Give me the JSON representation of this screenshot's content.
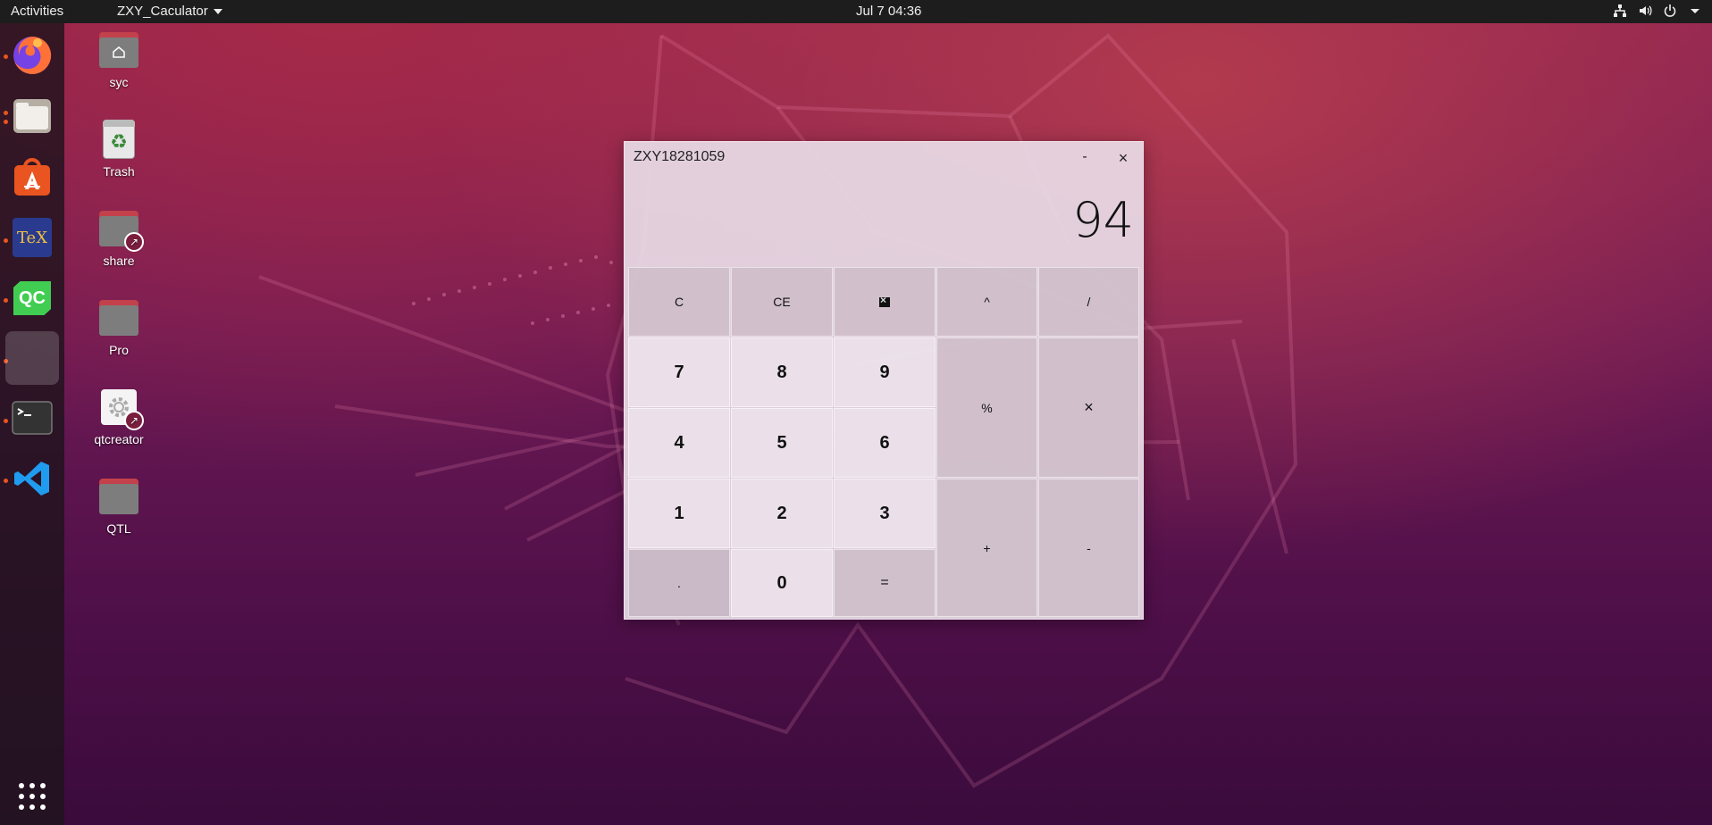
{
  "topbar": {
    "activities": "Activities",
    "app_menu": "ZXY_Caculator",
    "clock": "Jul 7  04:36",
    "tray_icons": [
      "network-icon",
      "volume-icon",
      "power-icon",
      "chevron-down-icon"
    ]
  },
  "dock": {
    "items": [
      {
        "name": "firefox",
        "icon": "firefox-icon",
        "running": true
      },
      {
        "name": "files",
        "icon": "files-icon",
        "running": true
      },
      {
        "name": "app-center",
        "icon": "app-center-icon",
        "running": false
      },
      {
        "name": "texstudio",
        "icon": "tex-icon",
        "running": true
      },
      {
        "name": "qt",
        "icon": "qt-icon",
        "running": true
      },
      {
        "name": "calculator",
        "icon": "blank-app-icon",
        "running": true,
        "active": true
      },
      {
        "name": "terminal",
        "icon": "terminal-icon",
        "running": true
      },
      {
        "name": "vscode",
        "icon": "vscode-icon",
        "running": true
      }
    ],
    "show_apps": "grid-icon",
    "qt_label": "QC",
    "tex_label": "TeX"
  },
  "desktop": {
    "icons": [
      {
        "label": "syc",
        "type": "home-folder"
      },
      {
        "label": "Trash",
        "type": "trash"
      },
      {
        "label": "share",
        "type": "folder-link"
      },
      {
        "label": "Pro",
        "type": "folder"
      },
      {
        "label": "qtcreator",
        "type": "app-link"
      },
      {
        "label": "QTL",
        "type": "folder"
      }
    ]
  },
  "calculator": {
    "title": "ZXY18281059",
    "minimize": "-",
    "close": "×",
    "display": "94",
    "keys": {
      "c": "C",
      "ce": "CE",
      "power": "^",
      "divide": "/",
      "seven": "7",
      "eight": "8",
      "nine": "9",
      "percent": "%",
      "multiply": "×",
      "four": "4",
      "five": "5",
      "six": "6",
      "one": "1",
      "two": "2",
      "three": "3",
      "plus": "+",
      "minus": "-",
      "dot": ".",
      "zero": "0",
      "equals": "="
    }
  },
  "colors": {
    "accent": "#e95420",
    "topbar": "#1d1d1d"
  }
}
